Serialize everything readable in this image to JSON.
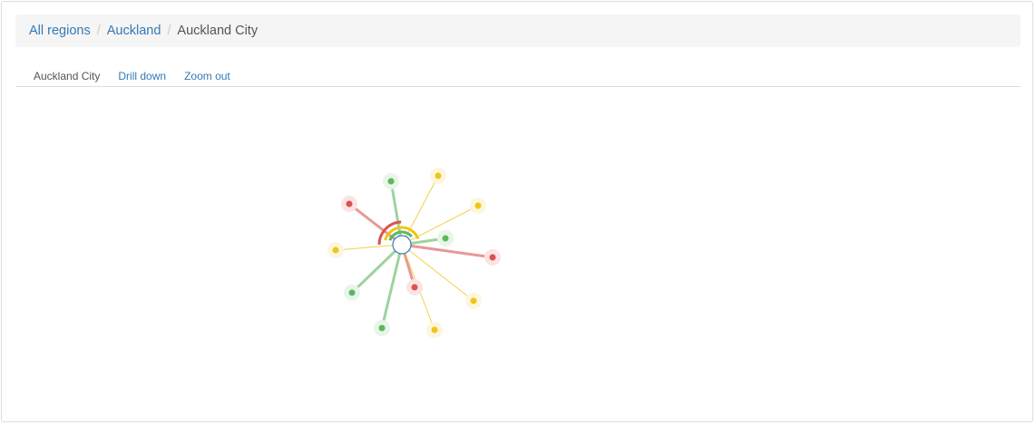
{
  "breadcrumb": {
    "items": [
      {
        "label": "All regions",
        "link": true
      },
      {
        "label": "Auckland",
        "link": true
      },
      {
        "label": "Auckland City",
        "link": false
      }
    ],
    "separator": "/"
  },
  "tabs": {
    "current": "Auckland City",
    "drill_down": "Drill down",
    "zoom_out": "Zoom out"
  },
  "colors": {
    "link": "#337ab7",
    "green": "#5cb85c",
    "yellow": "#f0c419",
    "red": "#d9534f",
    "center_stroke": "#337ab7"
  },
  "graph": {
    "nodes": [
      {
        "status": "green"
      },
      {
        "status": "yellow"
      },
      {
        "status": "yellow"
      },
      {
        "status": "red"
      },
      {
        "status": "green"
      },
      {
        "status": "yellow"
      },
      {
        "status": "red"
      },
      {
        "status": "yellow"
      },
      {
        "status": "red"
      },
      {
        "status": "yellow"
      },
      {
        "status": "green"
      },
      {
        "status": "green"
      }
    ]
  }
}
